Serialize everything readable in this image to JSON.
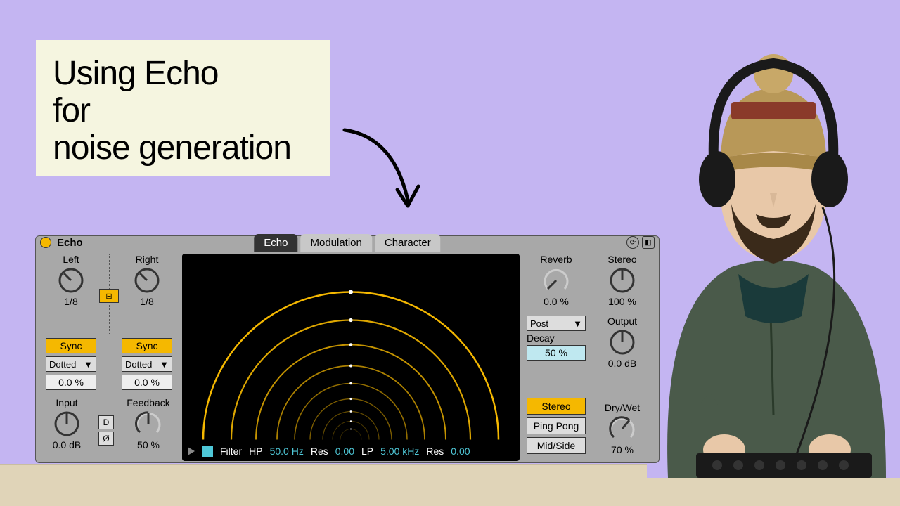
{
  "title_card": {
    "line1": "Using Echo",
    "line2": "for",
    "line3": "noise generation"
  },
  "device": {
    "name": "Echo",
    "tabs": [
      "Echo",
      "Modulation",
      "Character"
    ],
    "active_tab": 0,
    "left": {
      "label": "Left",
      "value": "1/8",
      "sync": "Sync",
      "mode": "Dotted",
      "offset": "0.0 %"
    },
    "right": {
      "label": "Right",
      "value": "1/8",
      "sync": "Sync",
      "mode": "Dotted",
      "offset": "0.0 %"
    },
    "input": {
      "label": "Input",
      "value": "0.0 dB"
    },
    "feedback": {
      "label": "Feedback",
      "value": "50 %"
    },
    "mini": {
      "d": "D",
      "phase": "Ø"
    },
    "filter": {
      "label": "Filter",
      "hp_label": "HP",
      "hp_freq": "50.0 Hz",
      "hp_res_label": "Res",
      "hp_res": "0.00",
      "lp_label": "LP",
      "lp_freq": "5.00 kHz",
      "lp_res_label": "Res",
      "lp_res": "0.00"
    },
    "reverb": {
      "label": "Reverb",
      "value": "0.0 %",
      "position": "Post",
      "decay_label": "Decay",
      "decay": "50 %"
    },
    "stereo": {
      "label": "Stereo",
      "value": "100 %"
    },
    "output": {
      "label": "Output",
      "value": "0.0 dB"
    },
    "drywet": {
      "label": "Dry/Wet",
      "value": "70 %"
    },
    "modes": [
      "Stereo",
      "Ping Pong",
      "Mid/Side"
    ],
    "active_mode": 0
  }
}
